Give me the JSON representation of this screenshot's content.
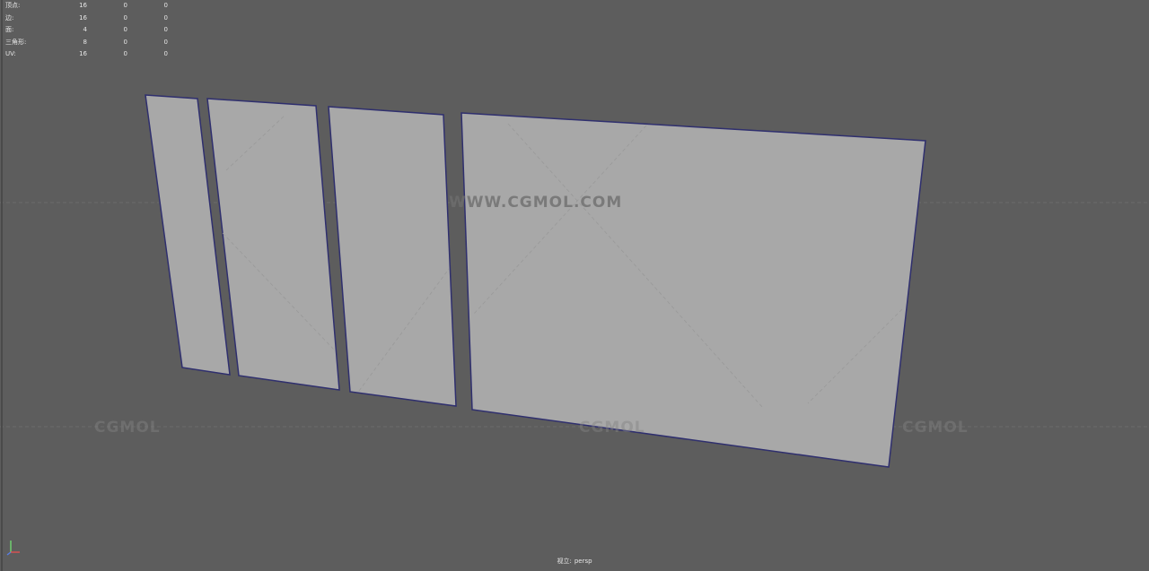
{
  "hud": {
    "rows": [
      {
        "label": "顶点:",
        "values": [
          "16",
          "0",
          "0"
        ]
      },
      {
        "label": "边:",
        "values": [
          "16",
          "0",
          "0"
        ]
      },
      {
        "label": "面:",
        "values": [
          "4",
          "0",
          "0"
        ]
      },
      {
        "label": "三角形:",
        "values": [
          "8",
          "0",
          "0"
        ]
      },
      {
        "label": "UV:",
        "values": [
          "16",
          "0",
          "0"
        ]
      }
    ]
  },
  "camera": {
    "prefix": "视立:",
    "name": "persp"
  },
  "watermarks": {
    "url": "WWW.CGMOL.COM",
    "brand": "CGMOL"
  },
  "colors": {
    "background": "#5d5d5d",
    "panel_fill": "#a8a8a8",
    "panel_edge": "#2f2f6e",
    "diagonal": "#969696"
  },
  "icons": {
    "axis": "xyz-axis-gizmo-icon"
  }
}
